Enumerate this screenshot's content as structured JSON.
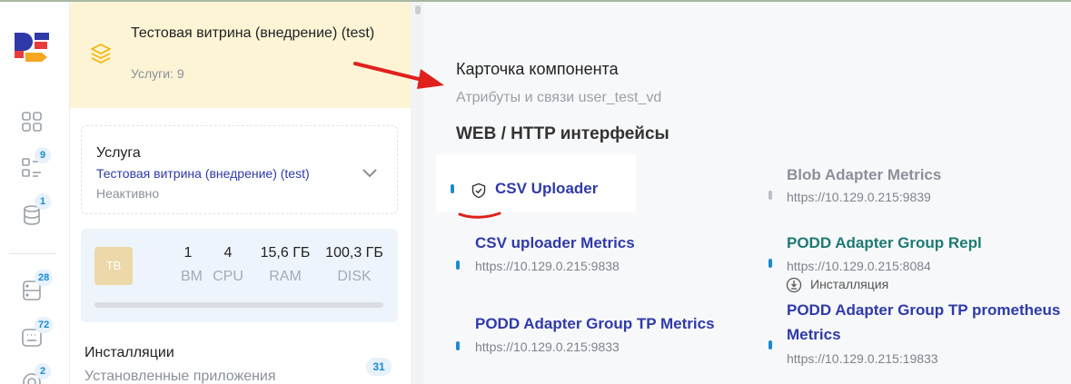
{
  "rail": {
    "logo_icon": "app-logo",
    "items": [
      {
        "icon": "grid-icon",
        "badge": ""
      },
      {
        "icon": "checklist-icon",
        "badge": "9"
      },
      {
        "icon": "database-icon",
        "badge": "1"
      },
      {
        "icon": "server-icon",
        "badge": "28"
      },
      {
        "icon": "keyboard-icon",
        "badge": "72"
      },
      {
        "icon": "settings-icon",
        "badge": "2"
      }
    ]
  },
  "showcase": {
    "title": "Тестовая витрина (внедрение) (test)",
    "services": "Услуги: 9",
    "icon": "layers-icon"
  },
  "service": {
    "label": "Услуга",
    "value": "Тестовая витрина (внедрение) (test)",
    "status": "Неактивно"
  },
  "resources": {
    "badge": "ТВ",
    "items": [
      {
        "value": "1",
        "label": "ВМ"
      },
      {
        "value": "4",
        "label": "CPU"
      },
      {
        "value": "15,6 ГБ",
        "label": "RAM"
      },
      {
        "value": "100,3 ГБ",
        "label": "DISK"
      }
    ]
  },
  "installs": {
    "title": "Инсталляции",
    "subtitle": "Установленные приложения",
    "count": "31"
  },
  "content": {
    "card_title": "Карточка компонента",
    "card_subtitle": "Атрибуты и связи user_test_vd",
    "section_title": "WEB / HTTP интерфейсы",
    "interfaces": [
      {
        "name": "CSV Uploader",
        "url": ""
      },
      {
        "name": "Blob Adapter Metrics",
        "url": "https://10.129.0.215:9839"
      },
      {
        "name": "CSV uploader Metrics",
        "url": "https://10.129.0.215:9838"
      },
      {
        "name": "PODD Adapter Group Repl",
        "url": "https://10.129.0.215:8084",
        "extra": "Инсталляция"
      },
      {
        "name": "PODD Adapter Group TP Metrics",
        "url": "https://10.129.0.215:9833"
      },
      {
        "name_line1": "PODD Adapter Group TP prometheus",
        "name_line2": "Metrics",
        "url": "https://10.129.0.215:19833"
      }
    ]
  },
  "colors": {
    "accent_blue": "#2f3aa8",
    "link_green": "#1f7a73",
    "badge_blue": "#1a8ad4",
    "showcase_bg": "#fdf4d6",
    "annotation_red": "#e0201c"
  }
}
